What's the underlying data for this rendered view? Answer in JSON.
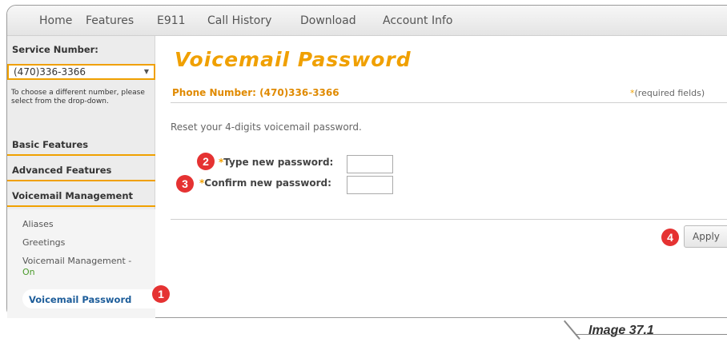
{
  "nav": {
    "items": [
      "Home",
      "Features",
      "E911",
      "Call History",
      "Download",
      "Account Info"
    ]
  },
  "sidebar": {
    "service_number_label": "Service Number:",
    "selected_number": "(470)336-3366",
    "hint": "To choose a different number, please select from the drop-down.",
    "sections": [
      "Basic Features",
      "Advanced Features",
      "Voicemail Management"
    ],
    "sub_items": [
      "Aliases",
      "Greetings",
      "Voicemail Management -",
      "On"
    ],
    "active_item": "Voicemail Password"
  },
  "page": {
    "title": "Voicemail Password",
    "phone_line": "Phone Number: (470)336-3366",
    "required_star": "*",
    "required_note": "(required fields)",
    "instructions": "Reset your 4-digits voicemail password.",
    "fields": {
      "new_password_label": "Type new password:",
      "new_password_value": "",
      "confirm_password_label": "Confirm new password:",
      "confirm_password_value": ""
    },
    "apply_label": "Apply"
  },
  "annotations": {
    "badges": [
      "1",
      "2",
      "3",
      "4"
    ],
    "caption": "Image 37.1"
  },
  "colors": {
    "accent": "#f0a000",
    "badge": "#e53232",
    "active_link": "#1d5d9a"
  }
}
